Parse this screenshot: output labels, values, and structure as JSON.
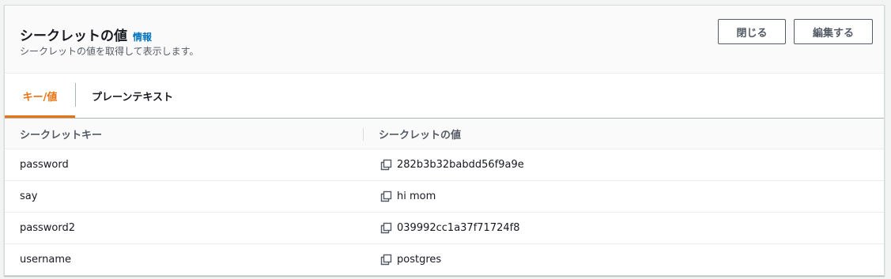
{
  "header": {
    "title": "シークレットの値",
    "info_link": "情報",
    "subtitle": "シークレットの値を取得して表示します。",
    "close_label": "閉じる",
    "edit_label": "編集する"
  },
  "tabs": [
    {
      "label": "キー/値",
      "active": true
    },
    {
      "label": "プレーンテキスト",
      "active": false
    }
  ],
  "table": {
    "columns": [
      "シークレットキー",
      "シークレットの値"
    ],
    "rows": [
      {
        "key": "password",
        "value": "282b3b32babdd56f9a9e"
      },
      {
        "key": "say",
        "value": "hi mom"
      },
      {
        "key": "password2",
        "value": "039992cc1a37f71724f8"
      },
      {
        "key": "username",
        "value": "postgres"
      }
    ]
  },
  "colors": {
    "accent": "#ec7211",
    "link": "#0073bb",
    "border": "#aab7b8"
  },
  "icons": {
    "copy": "copy-icon"
  }
}
